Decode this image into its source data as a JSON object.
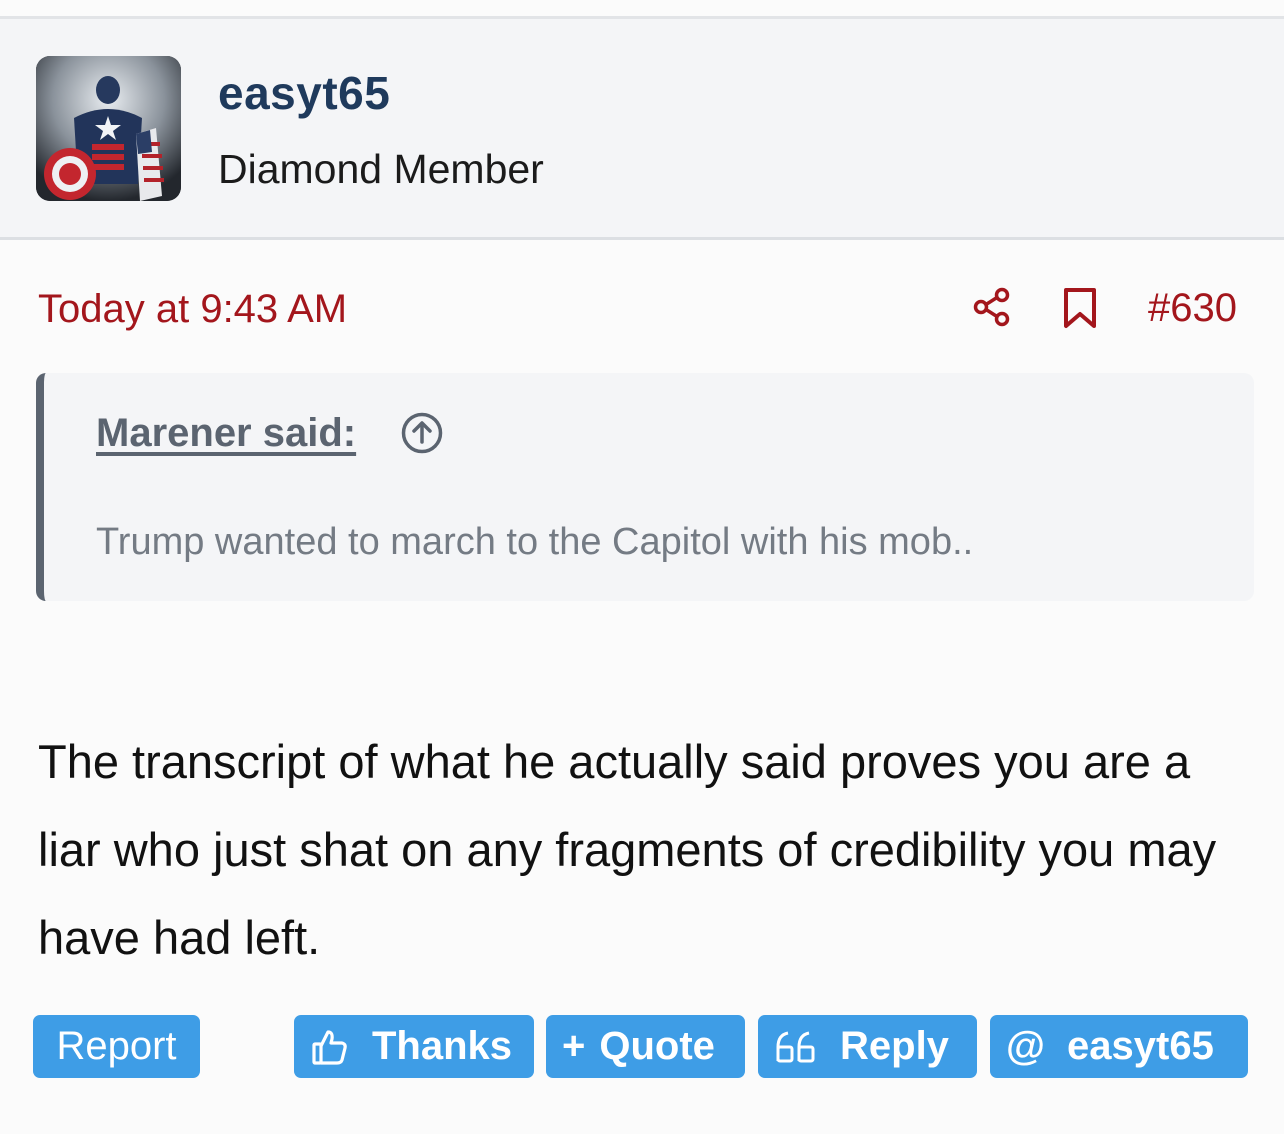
{
  "user": {
    "name": "easyt65",
    "title": "Diamond Member",
    "avatar_icon": "superhero-avatar"
  },
  "post": {
    "date": "Today at 9:43 AM",
    "number": "#630",
    "body": "The transcript of what he actually said proves you are a liar who just shat on any fragments of credibility you may have had left."
  },
  "quote": {
    "author": "Marener said:",
    "text": "Trump wanted to march to the Capitol with his mob.."
  },
  "actions": {
    "report": "Report",
    "thanks": "Thanks",
    "quote_glyph": "+",
    "quote": "Quote",
    "reply": "Reply",
    "mention_glyph": "@",
    "mention": "easyt65"
  },
  "colors": {
    "accent_red": "#a3161c",
    "button_blue": "#3e9de6",
    "username_navy": "#1f3a5c"
  },
  "icons": [
    "share-icon",
    "bookmark-icon",
    "arrow-up-circle-icon",
    "thumbs-up-icon",
    "quote-marks-icon"
  ]
}
